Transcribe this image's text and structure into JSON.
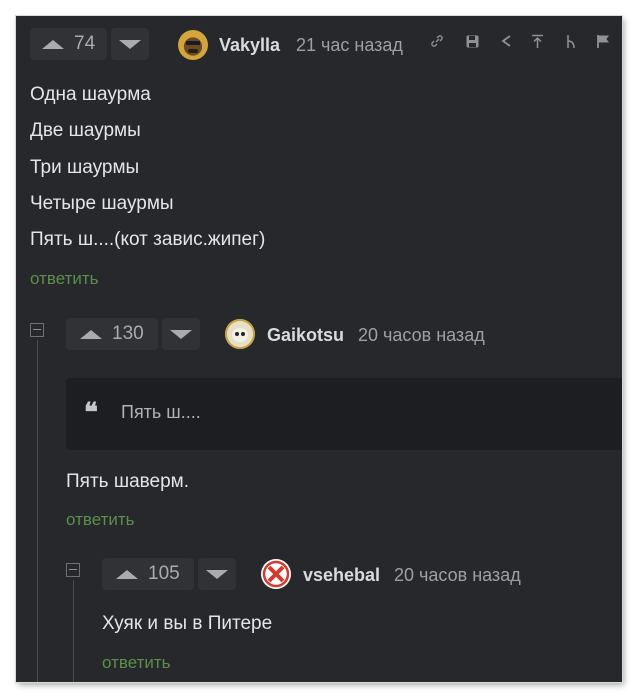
{
  "colors": {
    "background": "#26282c",
    "reply_link": "#5b8f4a",
    "text": "#e4e5e7"
  },
  "comments": [
    {
      "rating": "74",
      "author": "Vakylla",
      "time": "21 час назад",
      "avatar_icon": "avatar-image",
      "toolbar_icons": [
        "link-icon",
        "save-icon",
        "share-icon",
        "scroll-top-icon",
        "branch-icon",
        "flag-icon"
      ],
      "lines": [
        "Одна шаурма",
        "Две шаурмы",
        "Три шаурмы",
        "Четыре шаурмы",
        "Пять ш....(кот завис.жипег)"
      ],
      "reply": "ответить"
    },
    {
      "rating": "130",
      "author": "Gaikotsu",
      "time": "20 часов назад",
      "avatar_icon": "avatar-image",
      "quote": "Пять ш....",
      "lines": [
        "Пять шаверм."
      ],
      "reply": "ответить"
    },
    {
      "rating": "105",
      "author": "vsehebal",
      "time": "20 часов назад",
      "avatar_icon": "avatar-image",
      "lines": [
        "Хуяк и вы в Питере"
      ],
      "reply": "ответить"
    }
  ]
}
